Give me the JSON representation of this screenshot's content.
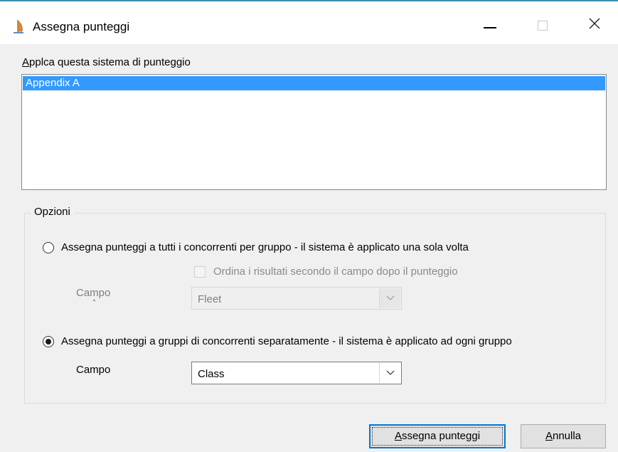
{
  "window": {
    "title": "Assegna punteggi",
    "accent_color": "#3a8fb0",
    "icons": {
      "app": "sailboat-icon",
      "minimize": "minimize-icon",
      "maximize": "maximize-icon",
      "close": "close-icon"
    }
  },
  "scoring_list": {
    "label_first": "A",
    "label_rest": "pplca questa sistema di punteggio",
    "items": [
      {
        "label": "Appendix A",
        "selected": true
      }
    ],
    "selection_color": "#3399ff"
  },
  "options": {
    "legend": "Opzioni",
    "option_all": {
      "label": "Assegna punteggi a tutti i concorrenti per gruppo  -  il sistema è applicato una sola volta",
      "selected": false,
      "sort_checkbox": {
        "label": "Ordina i risultati secondo il campo dopo il punteggio",
        "checked": false,
        "enabled": false
      },
      "field_label": "Campo",
      "field_value": "Fleet",
      "enabled": false
    },
    "option_groups": {
      "label": "Assegna punteggi a gruppi di concorrenti separatamente  -  il sistema è applicato ad ogni gruppo",
      "selected": true,
      "field_label": "Campo",
      "field_value": "Class"
    }
  },
  "buttons": {
    "assign_first": "A",
    "assign_rest": "ssegna punteggi",
    "cancel_first": "A",
    "cancel_rest": "nnulla",
    "focus_color": "#0078d7"
  }
}
